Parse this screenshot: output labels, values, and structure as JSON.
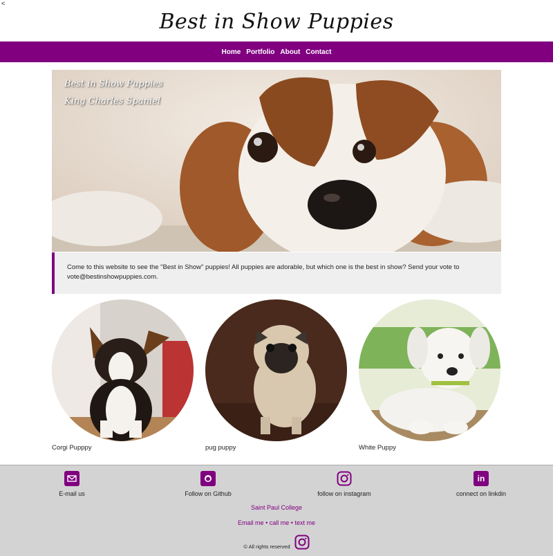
{
  "stray_char": "<",
  "site": {
    "title": "Best in Show Puppies"
  },
  "nav": {
    "items": [
      "Home",
      "Portfolio",
      "About",
      "Contact"
    ]
  },
  "hero": {
    "caption_line1": "Best in Show Puppies",
    "caption_line2": "King Charles Spaniel"
  },
  "intro": {
    "text": "Come to this website to see the \"Best in Show\" puppies! All puppies are adorable, but which one is the best in show? Send your vote to vote@bestinshowpuppies.com."
  },
  "puppies": [
    {
      "label": "Corgi Pupppy"
    },
    {
      "label": "pug puppy"
    },
    {
      "label": "White Puppy"
    }
  ],
  "footer": {
    "social": [
      {
        "label": "E-mail us",
        "icon": "mail-icon"
      },
      {
        "label": "Follow on Github",
        "icon": "github-icon"
      },
      {
        "label": "follow on instagram",
        "icon": "instagram-icon"
      },
      {
        "label": "connect on linkdin",
        "icon": "linkedin-icon"
      }
    ],
    "college": "Saint Paul College",
    "contact_email": "Email me",
    "contact_call": "call me",
    "contact_text": "text me",
    "separator": "•",
    "copyright": "© All rights reserved"
  },
  "colors": {
    "brand": "#800080",
    "footer_bg": "#d3d3d3",
    "intro_bg": "#efefef"
  }
}
